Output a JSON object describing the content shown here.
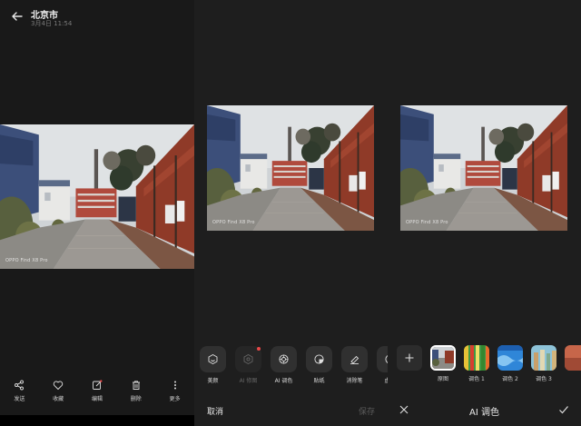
{
  "viewer": {
    "title": "北京市",
    "date": "3月4日 11:54",
    "watermark": "OPPO Find X8 Pro",
    "actions": [
      {
        "label": "发送",
        "icon": "share-icon"
      },
      {
        "label": "收藏",
        "icon": "heart-icon"
      },
      {
        "label": "编辑",
        "icon": "edit-icon"
      },
      {
        "label": "删除",
        "icon": "trash-icon"
      },
      {
        "label": "更多",
        "icon": "more-icon"
      }
    ]
  },
  "editor": {
    "watermark": "OPPO Find X8 Pro",
    "tools": [
      {
        "label": "美颜",
        "icon": "beauty-icon"
      },
      {
        "label": "AI 修图",
        "icon": "ai-retouch-icon"
      },
      {
        "label": "AI 调色",
        "icon": "ai-color-icon"
      },
      {
        "label": "贴纸",
        "icon": "sticker-icon"
      },
      {
        "label": "消除笔",
        "icon": "eraser-icon"
      },
      {
        "label": "虚化",
        "icon": "blur-icon"
      }
    ],
    "cancel_label": "取消",
    "save_label": "保存"
  },
  "ai_color": {
    "watermark": "OPPO Find X8 Pro",
    "title": "AI 调色",
    "filters": [
      {
        "label": "原图",
        "selected": true
      },
      {
        "label": "调色 1"
      },
      {
        "label": "调色 2"
      },
      {
        "label": "调色 3"
      }
    ]
  }
}
